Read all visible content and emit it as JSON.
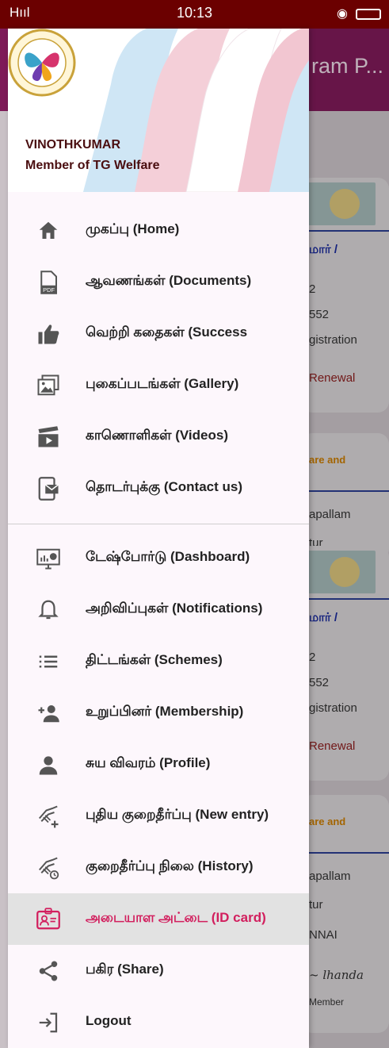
{
  "status_bar": {
    "signal": "Hııl",
    "time": "10:13"
  },
  "background": {
    "title": "ram P...",
    "card1": {
      "line1": "மார் /",
      "line2": "2",
      "line3": "552",
      "line4": "gistration",
      "line5": "Renewal"
    },
    "card2": {
      "line1": "are and",
      "line2": "apallam",
      "line3": "tur"
    },
    "card3": {
      "line1": "மார் /",
      "line2": "2",
      "line3": "552",
      "line4": "gistration",
      "line5": "Renewal"
    },
    "card4": {
      "line1": "are and",
      "line2": "apallam",
      "line3": "tur",
      "line4": "NNAI",
      "line5": "Member"
    }
  },
  "drawer": {
    "user_name": "VINOTHKUMAR",
    "user_role": "Member of TG Welfare",
    "menu_group1": [
      {
        "label": "முகப்பு (Home)",
        "icon": "home-icon"
      },
      {
        "label": "ஆவணங்கள் (Documents)",
        "icon": "pdf-icon"
      },
      {
        "label": "வெற்றி கதைகள் (Success",
        "icon": "thumbs-up-icon"
      },
      {
        "label": "புகைப்படங்கள் (Gallery)",
        "icon": "gallery-icon"
      },
      {
        "label": "காணொளிகள் (Videos)",
        "icon": "video-icon"
      },
      {
        "label": "தொடர்புக்கு (Contact us)",
        "icon": "contact-icon"
      }
    ],
    "menu_group2": [
      {
        "label": "டேஷ்போர்டு (Dashboard)",
        "icon": "dashboard-icon"
      },
      {
        "label": "அறிவிப்புகள் (Notifications)",
        "icon": "bell-icon"
      },
      {
        "label": "திட்டங்கள் (Schemes)",
        "icon": "list-icon"
      },
      {
        "label": "உறுப்பினர் (Membership)",
        "icon": "add-person-icon"
      },
      {
        "label": "சுய விவரம் (Profile)",
        "icon": "person-icon"
      },
      {
        "label": "புதிய குறைதீர்ப்பு (New entry)",
        "icon": "handshake-add-icon"
      },
      {
        "label": "குறைதீர்ப்பு நிலை (History)",
        "icon": "handshake-history-icon"
      },
      {
        "label": "அடையாள அட்டை (ID card)",
        "icon": "id-card-icon",
        "active": true
      },
      {
        "label": "பகிர (Share)",
        "icon": "share-icon"
      },
      {
        "label": "Logout",
        "icon": "logout-icon"
      }
    ],
    "active_color": "#d21f5e"
  }
}
